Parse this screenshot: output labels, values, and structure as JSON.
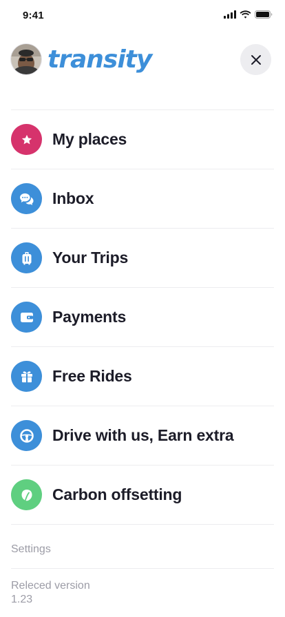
{
  "status_bar": {
    "time": "9:41"
  },
  "header": {
    "logo_text": "transity",
    "brand_color": "#3d8fd9"
  },
  "menu": {
    "items": [
      {
        "label": "My places",
        "icon": "star-icon",
        "color": "#d6336c"
      },
      {
        "label": "Inbox",
        "icon": "chat-bubbles-icon",
        "color": "#3d8fd9"
      },
      {
        "label": "Your Trips",
        "icon": "luggage-icon",
        "color": "#3d8fd9"
      },
      {
        "label": "Payments",
        "icon": "wallet-icon",
        "color": "#3d8fd9"
      },
      {
        "label": "Free Rides",
        "icon": "gift-icon",
        "color": "#3d8fd9"
      },
      {
        "label": "Drive with us, Earn extra",
        "icon": "steering-wheel-icon",
        "color": "#3d8fd9"
      },
      {
        "label": "Carbon offsetting",
        "icon": "leaf-icon",
        "color": "#5fcf80"
      }
    ]
  },
  "footer": {
    "settings_label": "Settings",
    "version_label": "Releced version",
    "version_number": "1.23"
  }
}
